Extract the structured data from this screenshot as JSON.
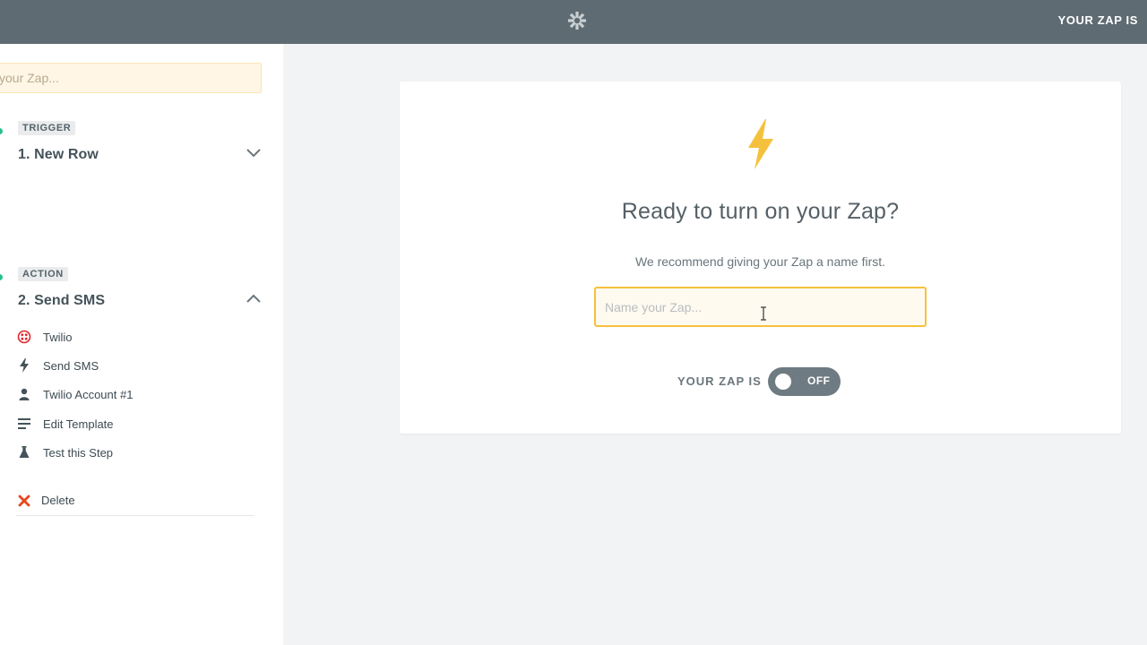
{
  "topbar": {
    "logo_icon": "zapier-asterisk-icon",
    "zap_status_label": "YOUR ZAP IS"
  },
  "sidebar": {
    "name_input_placeholder": "your Zap...",
    "steps": [
      {
        "badge": "TRIGGER",
        "title": "1. New Row",
        "expanded": false
      },
      {
        "badge": "ACTION",
        "title": "2. Send SMS",
        "expanded": true,
        "items": [
          {
            "label": "Twilio",
            "icon": "twilio-icon"
          },
          {
            "label": "Send SMS",
            "icon": "bolt-icon"
          },
          {
            "label": "Twilio Account #1",
            "icon": "user-icon"
          },
          {
            "label": "Edit Template",
            "icon": "lines-icon"
          },
          {
            "label": "Test this Step",
            "icon": "flask-icon"
          }
        ],
        "delete_label": "Delete"
      }
    ]
  },
  "card": {
    "headline": "Ready to turn on your Zap?",
    "subtext": "We recommend giving your Zap a name first.",
    "name_input_placeholder": "Name your Zap...",
    "toggle_label": "YOUR ZAP IS",
    "toggle_state": "OFF"
  },
  "colors": {
    "topbar": "#5f6b72",
    "accent_orange": "#f5c13c",
    "step_dot": "#27c08a",
    "twilio_red": "#e3242b",
    "delete_red": "#e8461b"
  }
}
